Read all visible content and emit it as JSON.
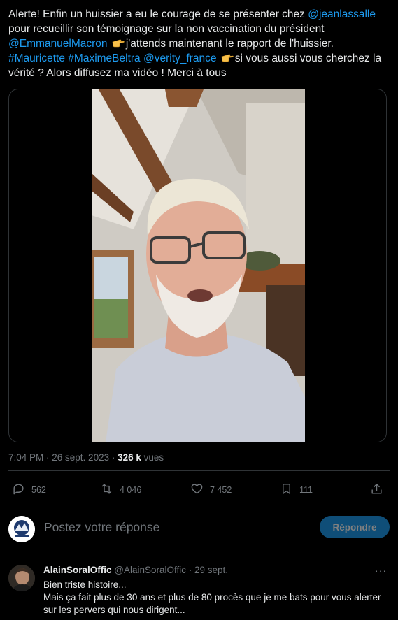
{
  "tweet": {
    "text_1": "Alerte! Enfin un huissier a eu le courage de se présenter chez ",
    "mention_1": "@jeanlassalle",
    "text_2": " pour recueillir son témoignage sur la non vaccination du président ",
    "mention_2": "@EmmanuelMacron",
    "text_3": "j'attends maintenant le rapport de l'huissier. ",
    "hashtag_1": "#Mauricette",
    "hashtag_2": "#MaximeBeltra",
    "mention_3": "@verity_france",
    "text_4": "si vous aussi vous cherchez la vérité ? Alors diffusez ma vidéo ! Merci à tous",
    "emoji_icon": "pointing-hand-emoji"
  },
  "meta": {
    "time_date": "7:04 PM · 26 sept. 2023 · ",
    "views_count": "326 k",
    "views_label": " vues"
  },
  "actions": {
    "replies": "562",
    "retweets": "4 046",
    "likes": "7 452",
    "bookmarks": "111"
  },
  "composer": {
    "placeholder": "Postez votre réponse",
    "button_label": "Répondre"
  },
  "reply": {
    "name": "AlainSoralOffic",
    "handle_time": " @AlainSoralOffic · 29 sept.",
    "more": "···",
    "line_1": "Bien triste histoire...",
    "line_2": "Mais ça fait plus de 30 ans et plus de 80 procès que je me bats pour vous alerter sur les pervers qui nous dirigent..."
  },
  "colors": {
    "background": "#000000",
    "text": "#e7e9ea",
    "muted": "#71767b",
    "link": "#1d9bf0",
    "border": "#2f3336",
    "button": "#0f4e78"
  }
}
